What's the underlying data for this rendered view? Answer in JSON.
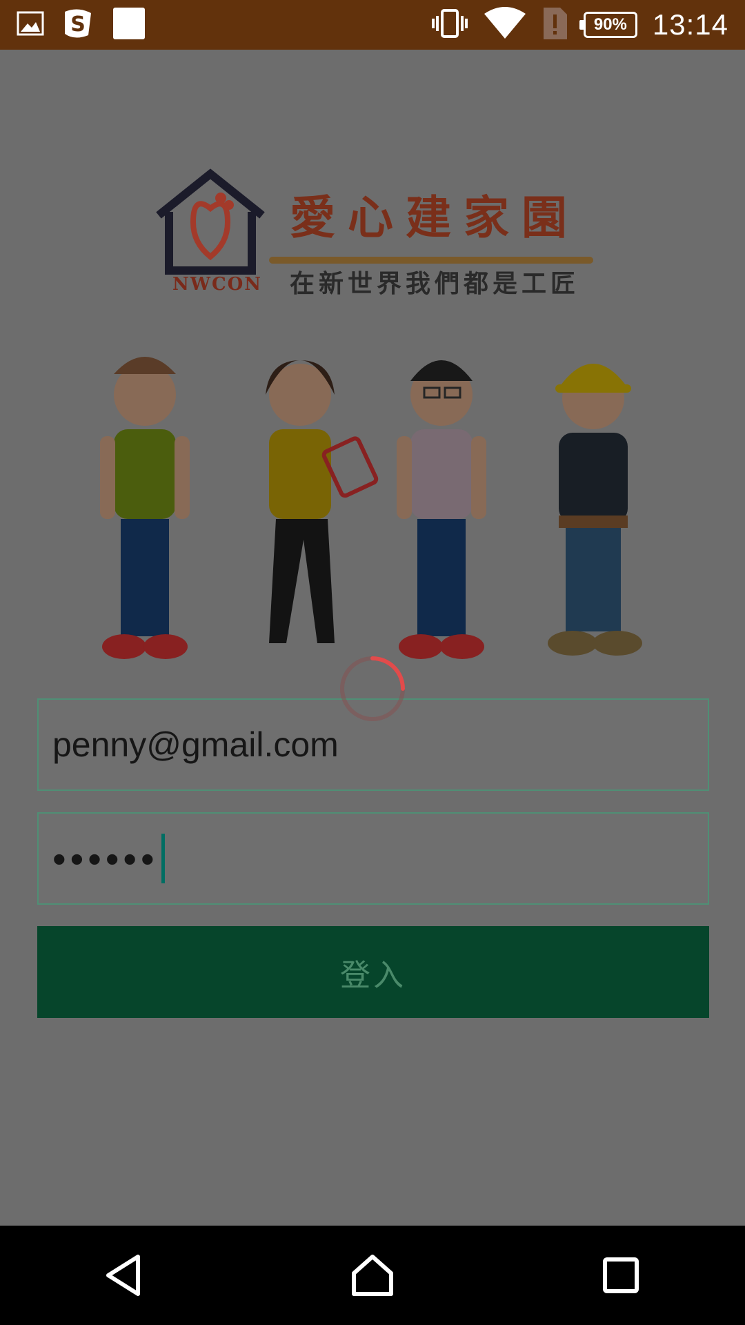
{
  "status_bar": {
    "time": "13:14",
    "battery_percent": "90%",
    "icons": [
      "image-icon",
      "s-app-icon",
      "white-square-icon",
      "vibrate-icon",
      "wifi-icon",
      "sim-alert-icon",
      "battery-icon"
    ]
  },
  "logo": {
    "title": "愛心建家園",
    "subtitle": "在新世界我們都是工匠",
    "brand": "NWCON"
  },
  "login_form": {
    "email_value": "penny@gmail.com",
    "password_mask": "••••••",
    "login_label": "登入"
  },
  "colors": {
    "status_bar": "#62320c",
    "background_dim": "#6d6d6d",
    "button": "#06452b",
    "input_border": "#4f8f75",
    "spinner": "#e24b4b"
  }
}
